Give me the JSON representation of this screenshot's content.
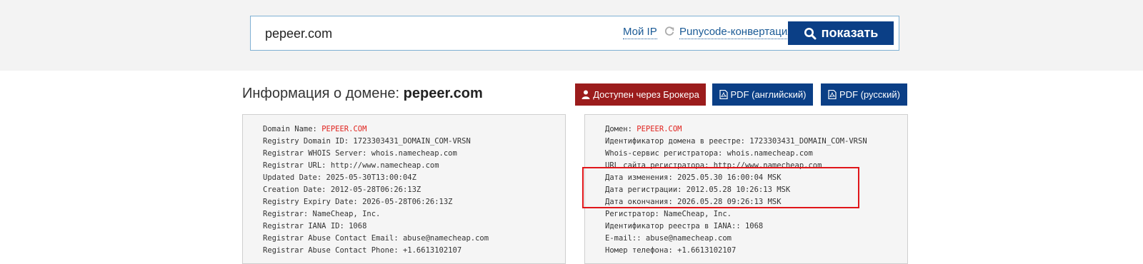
{
  "search": {
    "value": "pepeer.com",
    "my_ip_label": "Мой IP",
    "punycode_label": "Punycode-конвертация",
    "show_button_label": "показать"
  },
  "header": {
    "title_prefix": "Информация о домене:",
    "title_domain": "pepeer.com",
    "broker_button_label": "Доступен через Брокера",
    "pdf_en_label": "PDF (английский)",
    "pdf_ru_label": "PDF (русский)"
  },
  "whois_en": {
    "domain_name_label": "Domain Name:",
    "domain_name_value": "PEPEER.COM",
    "lines": [
      "Registry Domain ID: 1723303431_DOMAIN_COM-VRSN",
      "Registrar WHOIS Server: whois.namecheap.com",
      "Registrar URL: http://www.namecheap.com",
      "Updated Date: 2025-05-30T13:00:04Z",
      "Creation Date: 2012-05-28T06:26:13Z",
      "Registry Expiry Date: 2026-05-28T06:26:13Z",
      "Registrar: NameCheap, Inc.",
      "Registrar IANA ID: 1068",
      "Registrar Abuse Contact Email: abuse@namecheap.com",
      "Registrar Abuse Contact Phone: +1.6613102107"
    ]
  },
  "whois_ru": {
    "domain_name_label": "Домен:",
    "domain_name_value": "PEPEER.COM",
    "lines": [
      "Идентификатор домена в реестре: 1723303431_DOMAIN_COM-VRSN",
      "Whois-сервис регистратора: whois.namecheap.com",
      "URL сайта регистратора: http://www.namecheap.com",
      "Дата изменения: 2025.05.30 16:00:04 MSK",
      "Дата регистрации: 2012.05.28 10:26:13 MSK",
      "Дата окончания: 2026.05.28 09:26:13 MSK",
      "Регистратор: NameCheap, Inc.",
      "Идентификатор реестра в IANA:: 1068",
      "E-mail:: abuse@namecheap.com",
      "Номер телефона: +1.6613102107"
    ]
  },
  "colors": {
    "primary_button": "#0b3f86",
    "broker_button": "#9b1c1c",
    "link": "#1a5a96",
    "highlight": "#e0161a",
    "domain_value": "#e0231e"
  }
}
